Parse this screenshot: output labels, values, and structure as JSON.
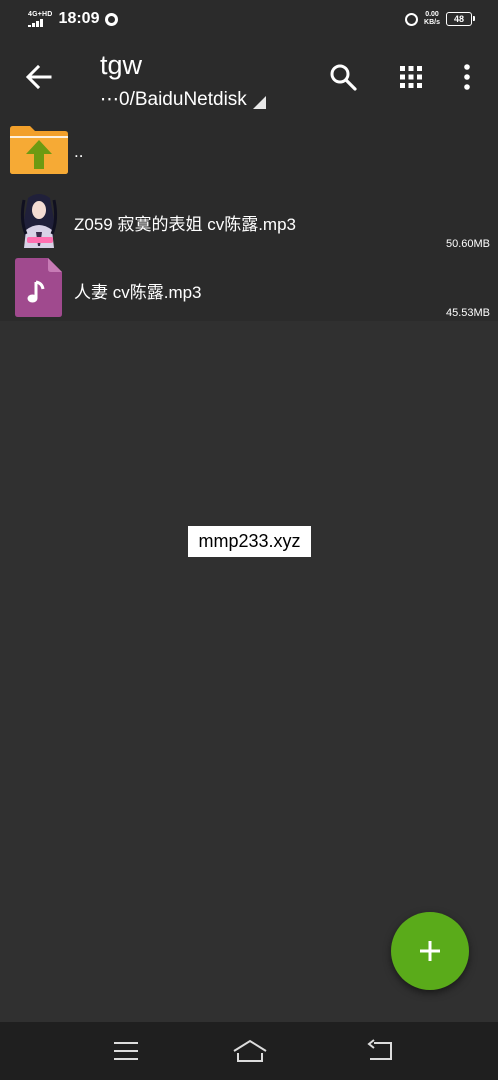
{
  "status_bar": {
    "network": "4G+HD",
    "time": "18:09",
    "net_speed_value": "0.00",
    "net_speed_unit": "KB/s",
    "battery": "48"
  },
  "toolbar": {
    "title": "tgw",
    "path": "⋯0/BaiduNetdisk"
  },
  "files": {
    "parent": {
      "name": ".."
    },
    "items": [
      {
        "name": "Z059 寂寞的表姐 cv陈露.mp3",
        "size": "50.60MB",
        "icon": "album-art-thumbnail"
      },
      {
        "name": "人妻 cv陈露.mp3",
        "size": "45.53MB",
        "icon": "music-file-icon"
      }
    ]
  },
  "watermark": "mmp233.xyz",
  "colors": {
    "fab": "#5aab1a",
    "folder": "#f2a02b",
    "up_arrow": "#6d9a12",
    "music_file": "#a04a8e",
    "background": "#303030"
  },
  "icons": [
    "back-arrow-icon",
    "search-icon",
    "grid-view-icon",
    "more-vert-icon",
    "folder-up-icon",
    "plus-icon",
    "menu-icon",
    "home-icon",
    "nav-back-icon"
  ]
}
